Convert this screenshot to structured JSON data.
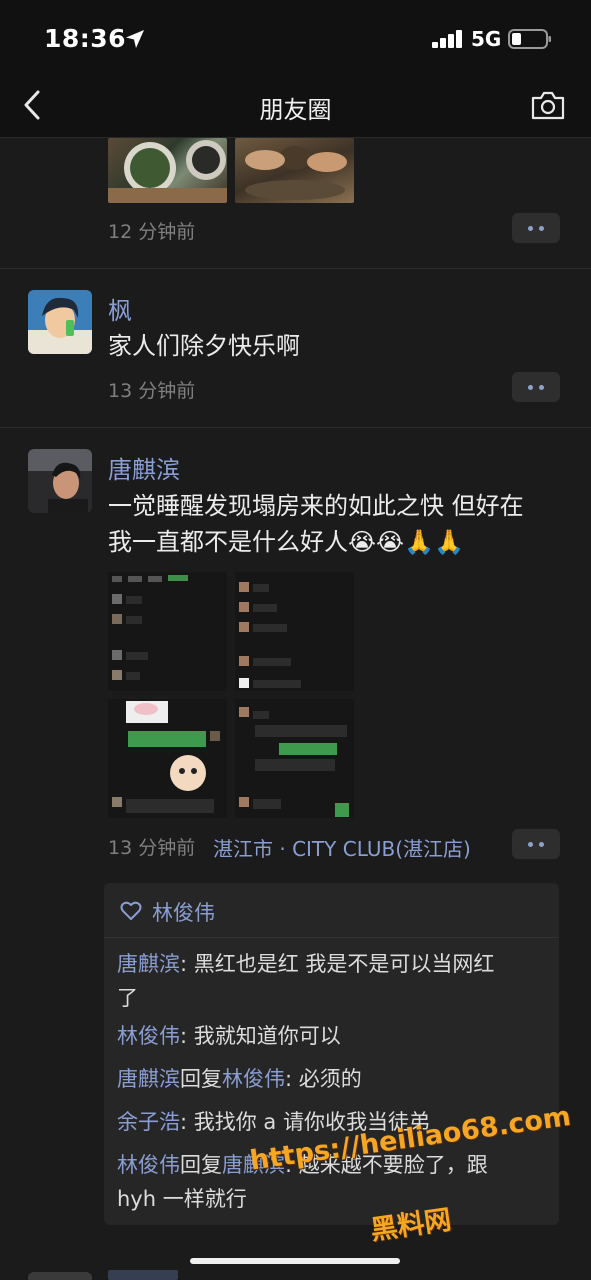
{
  "status_bar": {
    "time": "18:36",
    "network": "5G"
  },
  "nav": {
    "title": "朋友圈"
  },
  "posts": [
    {
      "time": "12 分钟前"
    },
    {
      "name": "枫",
      "text": "家人们除夕快乐啊",
      "time": "13 分钟前"
    },
    {
      "name": "唐麒滨",
      "text_line1": "一觉睡醒发现塌房来的如此之快 但好在",
      "text_line2": "我一直都不是什么好人😭😭🙏🙏",
      "time": "13 分钟前",
      "location": "湛江市 · CITY CLUB(湛江店)",
      "likes": "林俊伟",
      "comments": [
        {
          "name": "唐麒滨",
          "text": ": 黑红也是红 我是不是可以当网红",
          "cont": "了"
        },
        {
          "name": "林俊伟",
          "text": ": 我就知道你可以"
        },
        {
          "name": "唐麒滨",
          "reply_word": "回复",
          "reply_to": "林俊伟",
          "text": ": 必须的"
        },
        {
          "name": "余子浩",
          "text": ": 我找你 a 请你收我当徒弟"
        },
        {
          "name": "林俊伟",
          "reply_word": "回复",
          "reply_to": "唐麒滨",
          "text": ": 越来越不要脸了，跟",
          "cont": "hyh 一样就行"
        }
      ]
    }
  ],
  "watermark": {
    "url": "https://heiliao68.com",
    "label": "黑料网"
  },
  "icons": [
    "location-arrow-icon",
    "signal-bars-icon",
    "battery-icon",
    "back-chevron-icon",
    "camera-icon",
    "heart-icon",
    "more-dots-icon"
  ]
}
